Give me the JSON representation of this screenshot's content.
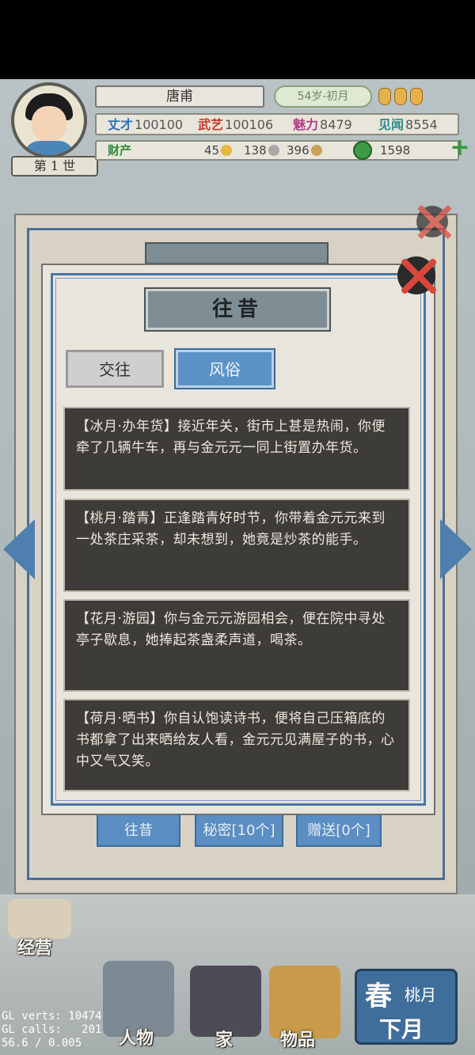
{
  "header": {
    "generation_label": "第 1 世",
    "name": "唐甫",
    "age": "54岁-初月",
    "stats": [
      {
        "label": "丈才",
        "value": "100100",
        "color": "#2f6fb3"
      },
      {
        "label": "武艺",
        "value": "100106",
        "color": "#c53a2e"
      },
      {
        "label": "魅力",
        "value": "8479",
        "color": "#b03d86"
      },
      {
        "label": "见闻",
        "value": "8554",
        "color": "#2e8a8a"
      }
    ],
    "assets_label": "财产",
    "resources": [
      "45",
      "138",
      "396"
    ],
    "jade": "1598",
    "add_symbol": "+"
  },
  "back_panel": {
    "tabs": [
      "往昔",
      "秘密[10个]",
      "赠送[0个]"
    ]
  },
  "modal": {
    "title": "往昔",
    "tabs": [
      {
        "label": "交往",
        "active": false
      },
      {
        "label": "风俗",
        "active": true
      }
    ],
    "entries": [
      {
        "text": "【冰月·办年货】接近年关，街市上甚是热闹，你便牵了几辆牛车，再与金元元一同上街置办年货。"
      },
      {
        "text": "【桃月·踏青】正逢踏青好时节，你带着金元元来到一处茶庄采茶，却未想到，她竟是炒茶的能手。"
      },
      {
        "text": "【花月·游园】你与金元元游园相会，便在院中寻处亭子歇息，她捧起茶盏柔声道，喝茶。"
      },
      {
        "text": "【荷月·晒书】你自认饱读诗书，便将自己压箱底的书都拿了出来晒给友人看，金元元见满屋子的书，心中又气又笑。"
      }
    ]
  },
  "bottom_nav": {
    "items": [
      "经营",
      "人物",
      "家",
      "物品"
    ],
    "season": "春",
    "month": "桃月",
    "next_month": "下月"
  },
  "debug": {
    "line1": "GL verts: 10474",
    "line2": "GL calls:   201",
    "line3": "56.6 / 0.005"
  }
}
